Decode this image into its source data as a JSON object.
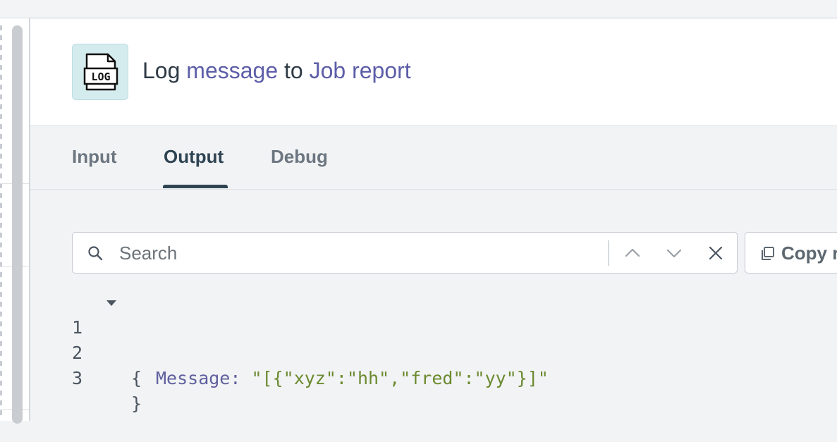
{
  "header": {
    "title_prefix": "Log",
    "title_link1": "message",
    "title_mid": "to",
    "title_link2": "Job report",
    "icon": "log-document-icon",
    "icon_text": "LOG"
  },
  "tabs": [
    {
      "label": "Input",
      "active": false
    },
    {
      "label": "Output",
      "active": true
    },
    {
      "label": "Debug",
      "active": false
    }
  ],
  "search": {
    "placeholder": "Search",
    "icons": [
      "search-icon",
      "chevron-up-icon",
      "chevron-down-icon",
      "close-icon"
    ]
  },
  "copy_button": {
    "label": "Copy r",
    "icon": "copy-icon"
  },
  "code": {
    "lines": [
      {
        "num": "1",
        "text": "{"
      },
      {
        "num": "2",
        "key": "Message:",
        "value": "\"[{\"xyz\":\"hh\",\"fred\":\"yy\"}]\""
      },
      {
        "num": "3",
        "text": "}"
      }
    ]
  },
  "colors": {
    "accent": "#5d5ea8",
    "tab_active": "#2f4452",
    "icon_bg": "#d5ecef",
    "string": "#6b8a2f"
  }
}
